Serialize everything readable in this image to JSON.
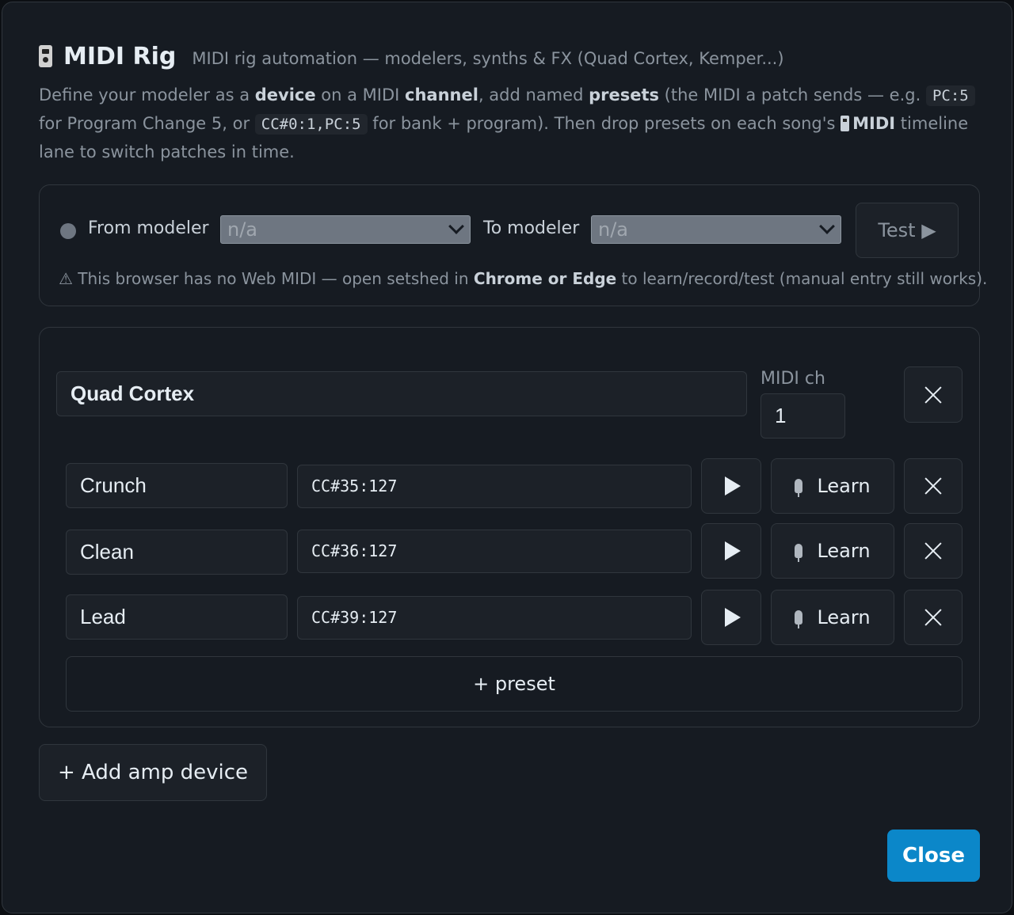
{
  "header": {
    "title": "MIDI Rig",
    "subtitle": "MIDI rig automation — modelers, synths & FX (Quad Cortex, Kemper...)"
  },
  "description": {
    "p1": "Define your modeler as a ",
    "b1": "device",
    "p2": " on a MIDI ",
    "b2": "channel",
    "p3": ", add named ",
    "b3": "presets",
    "p4": " (the MIDI a patch sends — e.g. ",
    "code1": "PC:5",
    "p5": " for Program Change 5, or ",
    "code2": "CC#0:1,PC:5",
    "p6": " for bank + program). Then drop presets on each song's ",
    "b4": "MIDI",
    "p7": " timeline lane to switch patches in time."
  },
  "io": {
    "from_label": "From modeler",
    "from_value": "n/a",
    "to_label": "To modeler",
    "to_value": "n/a",
    "test_label": "Test ▶",
    "warning_pre": "⚠ This browser has no Web MIDI — open setshed in ",
    "warning_bold": "Chrome or Edge",
    "warning_post": " to learn/record/test (manual entry still works)."
  },
  "device": {
    "name": "Quad Cortex",
    "channel_label": "MIDI ch",
    "channel": "1",
    "presets": [
      {
        "name": "Crunch",
        "midi": "CC#35:127",
        "learn_label": "Learn"
      },
      {
        "name": "Clean",
        "midi": "CC#36:127",
        "learn_label": "Learn"
      },
      {
        "name": "Lead",
        "midi": "CC#39:127",
        "learn_label": "Learn"
      }
    ],
    "add_preset_label": "+  preset"
  },
  "add_amp_label": "+  Add amp device",
  "close_label": "Close",
  "colors": {
    "background": "#161b22",
    "accent": "#0b87c9",
    "border": "#30363d"
  }
}
